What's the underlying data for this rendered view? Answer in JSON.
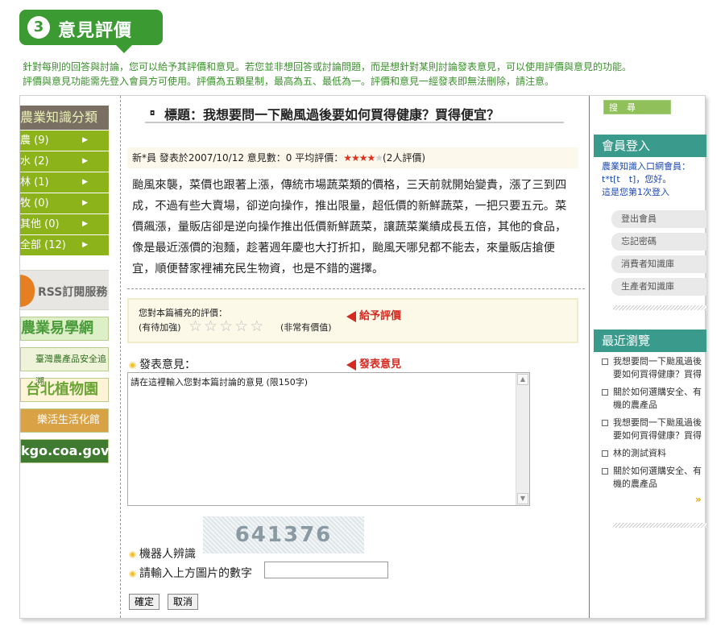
{
  "header": {
    "number": "3",
    "title": "意見評價"
  },
  "intro": [
    "針對每則的回答與討論，您可以給予其評價和意見。若您並非想回答或討論問題，而是想針對某則討論發表意見，可以使用評價與意見的功能。",
    "評價與意見功能需先登入會員方可使用。評價為五顆星制，最高為五、最低為一。評價和意見一經發表即無法刪除，請注意。"
  ],
  "left_sidebar": {
    "heading": "農業知識分類",
    "categories": [
      {
        "label": "農 (9)"
      },
      {
        "label": "水 (2)"
      },
      {
        "label": "林 (1)"
      },
      {
        "label": "牧 (0)"
      },
      {
        "label": "其他 (0)"
      },
      {
        "label": "全部 (12)"
      }
    ],
    "rss_label": "RSS訂閱服務",
    "banners": [
      "農業易學網",
      "臺灣農產品安全追溯",
      "台北植物園",
      "樂活生活化館",
      "kgo.coa.gov.tw"
    ]
  },
  "topic": {
    "prefix": "標題：",
    "title": "我想要問一下颱風過後要如何買得健康？買得便宜？",
    "meta_prefix": "新*員 發表於2007/10/12 意見數：0 平均評價：",
    "rating_count": "(2人評價)",
    "body": "颱風來襲，菜價也跟著上漲，傳統市場蔬菜類的價格，三天前就開始變貴，漲了三到四成，不過有些大賣場，卻逆向操作，推出限量，超低價的新鮮蔬菜，一把只要五元。菜價飆漲，量販店卻是逆向操作推出低價新鮮蔬菜，讓蔬菜業績成長五倍，其他的食品，像是最近漲價的泡麵，趁著週年慶也大打折扣，颱風天哪兒都不能去，來量販店搶便宜，順便替家裡補充民生物資，也是不錯的選擇。"
  },
  "rating_form": {
    "prompt": "您對本篇補充的評價：",
    "low_label": "(有待加強)",
    "high_label": "(非常有價值)",
    "annotation": "給予評價"
  },
  "comment_form": {
    "label": "發表意見：",
    "annotation": "發表意見",
    "value": "請在這裡輸入您對本篇討論的意見 (限150字)",
    "captcha_text": "641376",
    "robot_label": "機器人辨識",
    "captcha_label": "請輸入上方圖片的數字",
    "captcha_value": "",
    "submit_label": "確定",
    "cancel_label": "取消"
  },
  "right_sidebar": {
    "search_label": "搜　尋",
    "login_heading": "會員登入",
    "welcome_lines": [
      "農業知識入口網會員：",
      "t*t[t　t]，您好。",
      "這是您第1次登入"
    ],
    "member_buttons": [
      "登出會員",
      "忘記密碼",
      "消費者知識庫",
      "生產者知識庫"
    ],
    "recent_heading": "最近瀏覽",
    "recent_items": [
      "我想要問一下颱風過後要如何買得健康？買得便宜？",
      "關於如何選購安全、有機的農產品",
      "我想要問一下颱風過後要如何買得健康？買得便宜？",
      "林的測試資料",
      "關於如何選購安全、有機的農產品"
    ],
    "more_link": "»"
  },
  "colors": {
    "brand_green": "#3c9a33",
    "category_green": "#8db31b",
    "panel_teal": "#3a9a8c",
    "star_red": "#e0311c"
  }
}
